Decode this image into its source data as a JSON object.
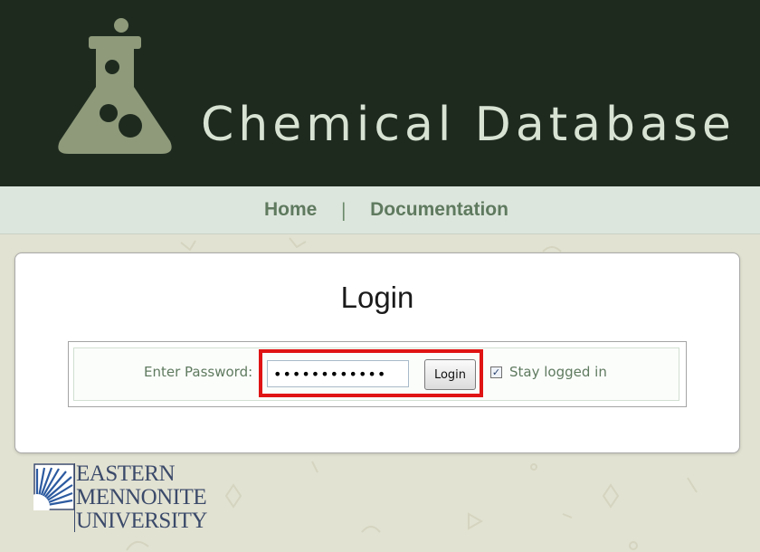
{
  "header": {
    "title": "Chemical Database",
    "logo_icon": "flask-icon"
  },
  "nav": {
    "home": "Home",
    "separator": "|",
    "documentation": "Documentation"
  },
  "login": {
    "title": "Login",
    "password_label": "Enter Password:",
    "password_value": "••••••••••••",
    "button_label": "Login",
    "stay_logged_in_label": "Stay logged in",
    "stay_logged_in_checked": true
  },
  "footer": {
    "org_line1": "EASTERN",
    "org_line2": "MENNONITE",
    "org_line3": "UNIVERSITY"
  },
  "colors": {
    "header_bg": "#1f2a1f",
    "nav_bg": "#dde6dd",
    "accent_green": "#5f7a5f",
    "highlight": "#e01414"
  }
}
